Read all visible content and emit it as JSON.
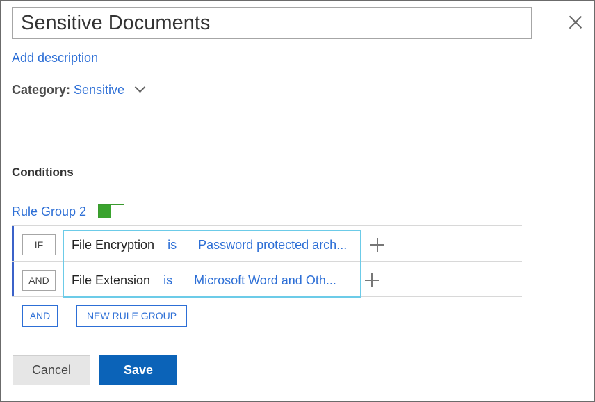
{
  "dialog": {
    "title_value": "Sensitive Documents",
    "add_description": "Add description",
    "category_label": "Category:",
    "category_value": "Sensitive"
  },
  "conditions": {
    "heading": "Conditions",
    "rule_group": {
      "title": "Rule Group 2",
      "enabled": true,
      "rows": [
        {
          "operator": "IF",
          "field": "File Encryption",
          "comparator": "is",
          "value": "Password protected arch..."
        },
        {
          "operator": "AND",
          "field": "File Extension",
          "comparator": "is",
          "value": "Microsoft Word and Oth..."
        }
      ]
    },
    "and_button": "AND",
    "new_rule_group_button": "NEW RULE GROUP"
  },
  "footer": {
    "cancel_label": "Cancel",
    "save_label": "Save"
  },
  "colors": {
    "link": "#2d6fd6",
    "primary": "#0b63b8",
    "toggle_on": "#3aa32e",
    "selection_border": "#6ccbe8"
  }
}
